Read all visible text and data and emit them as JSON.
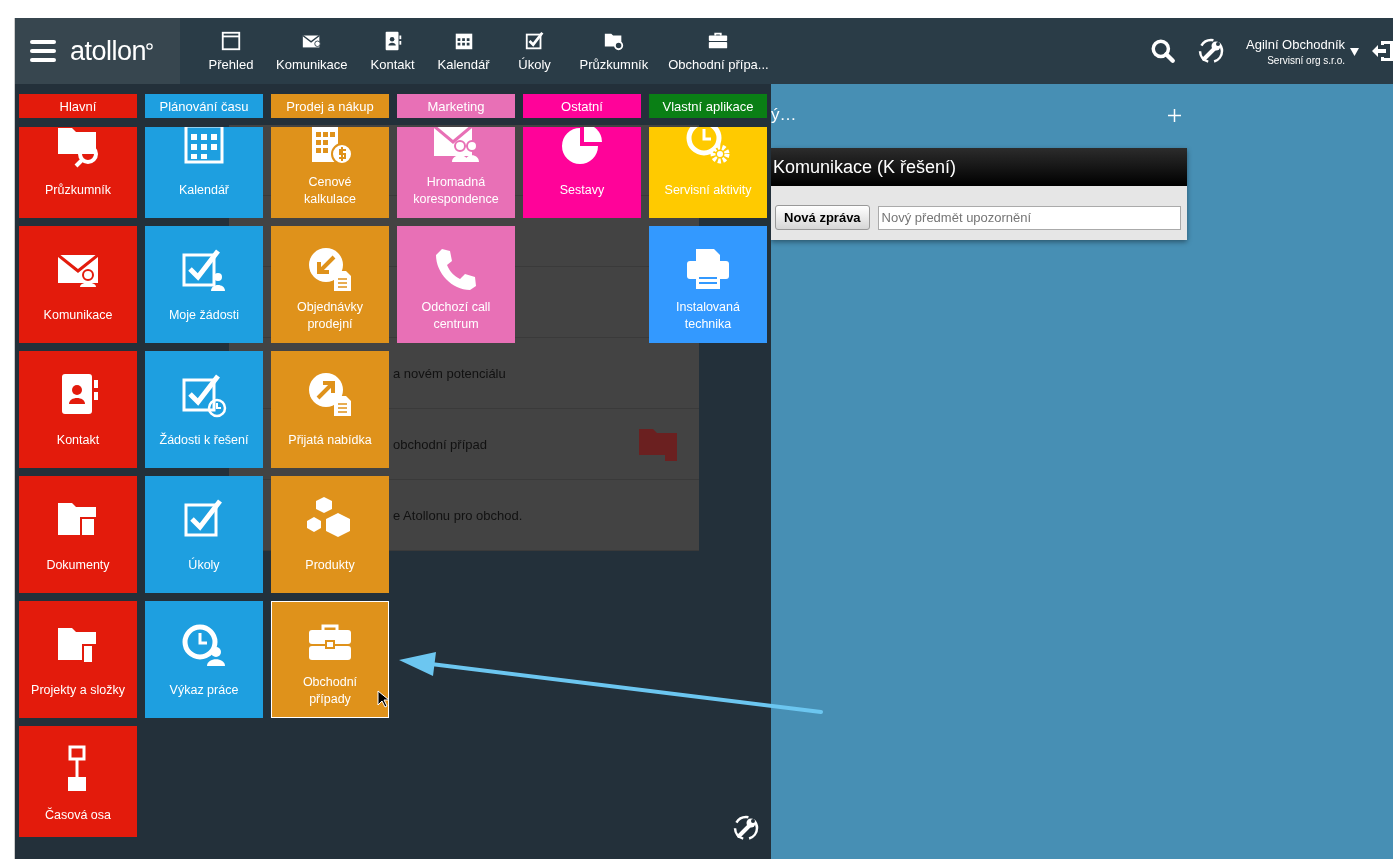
{
  "topbar": {
    "logo": "atollon",
    "nav": [
      {
        "label": "Přehled"
      },
      {
        "label": "Komunikace"
      },
      {
        "label": "Kontakt"
      },
      {
        "label": "Kalendář"
      },
      {
        "label": "Úkoly"
      },
      {
        "label": "Průzkumník"
      },
      {
        "label": "Obchodní přípa..."
      }
    ],
    "user": {
      "name": "Agilní Obchodník",
      "org": "Servisní org s.r.o."
    }
  },
  "menu": {
    "categories": [
      {
        "label": "Hlavní",
        "color": "#e31b0c",
        "tiles": [
          {
            "label": "Průzkumník",
            "color": "#e31b0c",
            "selected": false
          },
          {
            "label": "Komunikace",
            "color": "#e31b0c",
            "selected": false
          },
          {
            "label": "Kontakt",
            "color": "#e31b0c",
            "selected": false
          },
          {
            "label": "Dokumenty",
            "color": "#e31b0c",
            "selected": false
          },
          {
            "label": "Projekty a složky",
            "color": "#e31b0c",
            "selected": false
          },
          {
            "label": "Časová osa",
            "color": "#e31b0c",
            "selected": false
          }
        ]
      },
      {
        "label": "Plánování času",
        "color": "#1e9fe0",
        "tiles": [
          {
            "label": "Kalendář",
            "color": "#1e9fe0",
            "selected": false
          },
          {
            "label": "Moje žádosti",
            "color": "#1e9fe0",
            "selected": false
          },
          {
            "label": "Žádosti k řešení",
            "color": "#1e9fe0",
            "selected": false
          },
          {
            "label": "Úkoly",
            "color": "#1e9fe0",
            "selected": false
          },
          {
            "label": "Výkaz práce",
            "color": "#1e9fe0",
            "selected": false
          }
        ]
      },
      {
        "label": "Prodej a nákup",
        "color": "#df921b",
        "tiles": [
          {
            "label": "Cenové\nkalkulace",
            "color": "#df921b",
            "selected": false
          },
          {
            "label": "Objednávky\nprodejní",
            "color": "#df921b",
            "selected": false
          },
          {
            "label": "Přijatá nabídka",
            "color": "#df921b",
            "selected": false
          },
          {
            "label": "Produkty",
            "color": "#df921b",
            "selected": false
          },
          {
            "label": "Obchodní\npřípady",
            "color": "#df921b",
            "selected": true
          }
        ]
      },
      {
        "label": "Marketing",
        "color": "#e870b6",
        "tiles": [
          {
            "label": "Hromadná\nkorespondence",
            "color": "#e870b6",
            "selected": false
          },
          {
            "label": "Odchozí call\ncentrum",
            "color": "#e870b6",
            "selected": false
          }
        ]
      },
      {
        "label": "Ostatní",
        "color": "#ff0399",
        "tiles": [
          {
            "label": "Sestavy",
            "color": "#ff0399",
            "selected": false
          }
        ]
      },
      {
        "label": "Vlastní aplikace",
        "color": "#0a7f15",
        "tiles": [
          {
            "label": "Servisní aktivity",
            "color": "#ffca00",
            "selected": false
          },
          {
            "label": "Instalovaná\ntechnika",
            "color": "#3399ff",
            "selected": false
          }
        ]
      }
    ]
  },
  "dashboard": {
    "panel_rows": [
      "a novém potenciálu",
      "obchodní případ",
      "e Atollonu pro obchod."
    ],
    "heading": "ý…",
    "widget": {
      "title": "Komunikace (K řešení)",
      "button": "Nová zpráva",
      "placeholder": "Nový předmět upozornění"
    }
  }
}
